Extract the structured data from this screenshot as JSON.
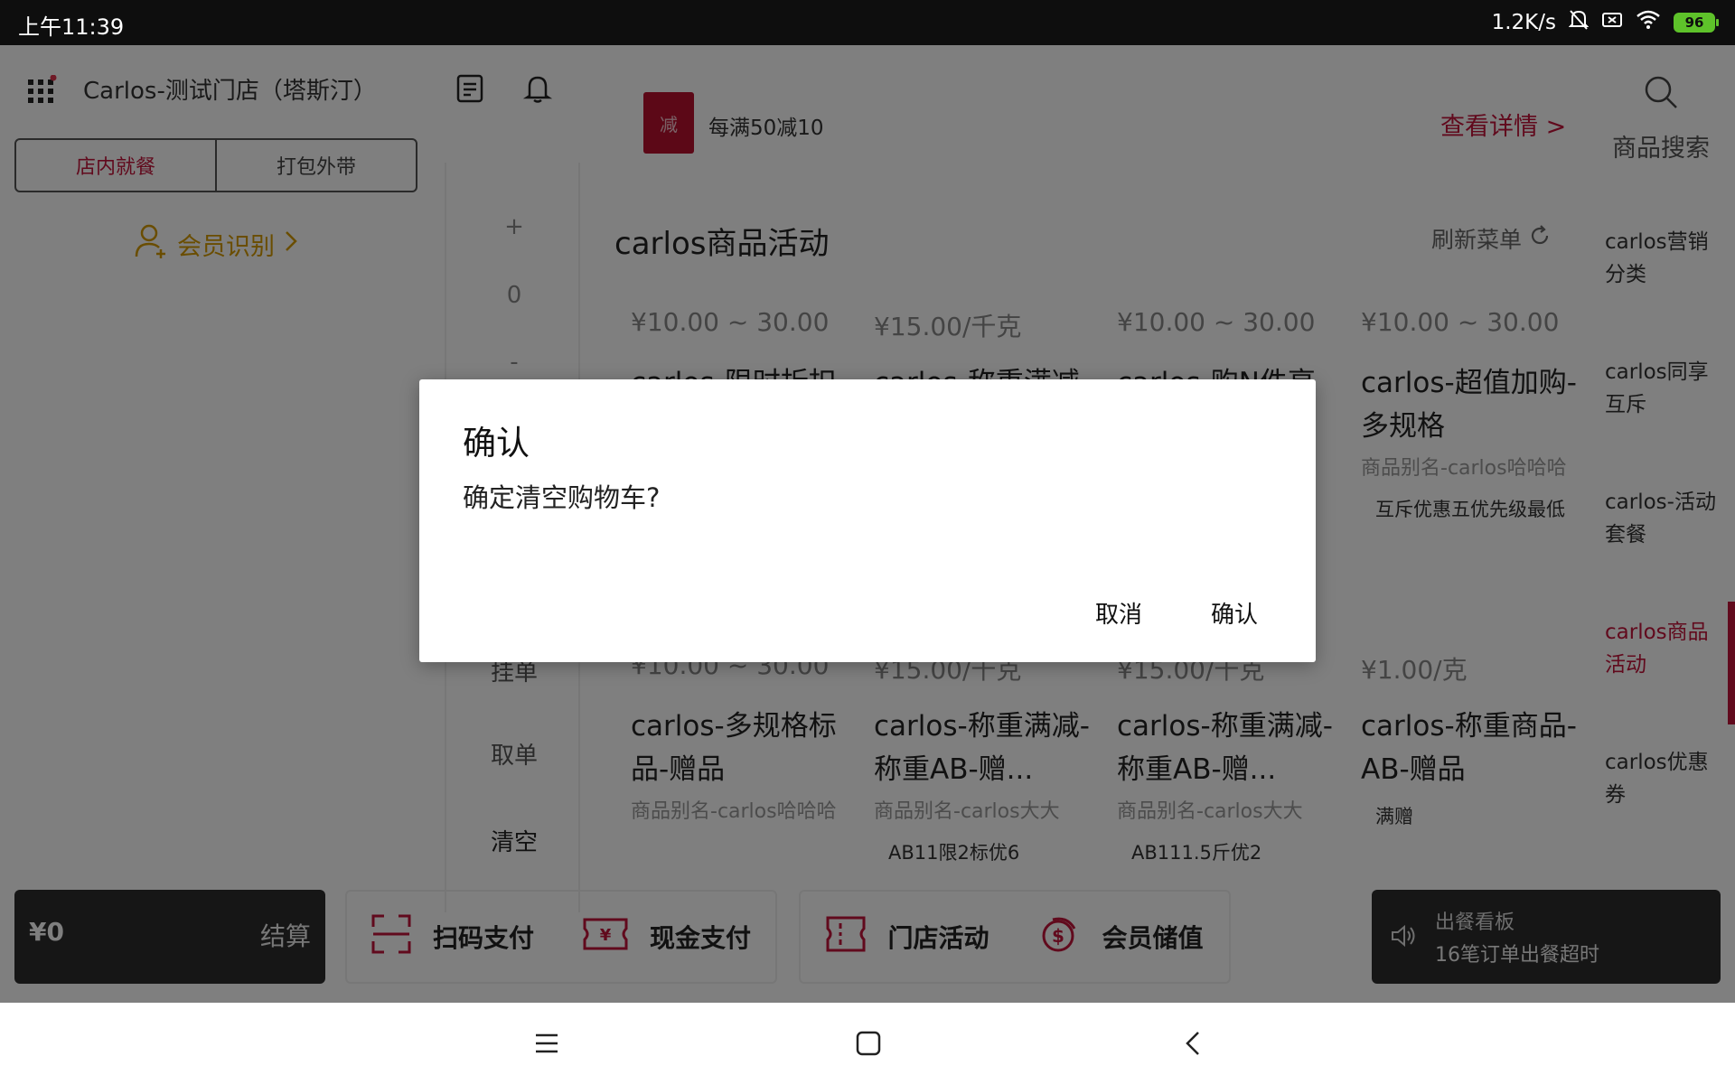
{
  "status_bar": {
    "time": "上午11:39",
    "net_speed": "1.2K/s",
    "battery": "96"
  },
  "header": {
    "store_name": "Carlos-测试门店（塔斯汀）"
  },
  "mode_tabs": [
    {
      "label": "店内就餐"
    },
    {
      "label": "打包外带"
    }
  ],
  "member": {
    "label": "会员识别"
  },
  "cart": {
    "plus": "+",
    "qty": "0",
    "minus": "-",
    "partial_label": "挂单",
    "cancel_order": "取单",
    "clear": "清空"
  },
  "promo": {
    "badge": "减",
    "text": "每满50减10",
    "detail_link": "查看详情 >"
  },
  "search": {
    "label": "商品搜索"
  },
  "categories": [
    {
      "label": "carlos营销分类"
    },
    {
      "label": "carlos同享互斥"
    },
    {
      "label": "carlos-活动套餐"
    },
    {
      "label": "carlos商品活动"
    },
    {
      "label": "carlos优惠券"
    }
  ],
  "section": {
    "title": "carlos商品活动",
    "refresh": "刷新菜单"
  },
  "products_row1": [
    {
      "price": "¥10.00 ~ 30.00",
      "name": "carlos-限时折扣",
      "alias": "",
      "tag": ""
    },
    {
      "price": "¥15.00/千克",
      "name": "carlos-称重满减",
      "alias": "",
      "tag": ""
    },
    {
      "price": "¥10.00 ~ 30.00",
      "name": "carlos-购N件享",
      "alias": "",
      "tag": ""
    },
    {
      "price": "¥10.00 ~ 30.00",
      "name": "carlos-超值加购-多规格",
      "alias": "商品别名-carlos哈哈哈",
      "tag": "互斥优惠五优先级最低"
    }
  ],
  "products_row2": [
    {
      "price": "¥10.00 ~ 30.00",
      "name": "carlos-多规格标品-赠品",
      "alias": "商品别名-carlos哈哈哈",
      "tag": ""
    },
    {
      "price": "¥15.00/千克",
      "name": "carlos-称重满减-称重AB-赠...",
      "alias": "商品别名-carlos大大",
      "tag": "AB11限2标优6"
    },
    {
      "price": "¥15.00/千克",
      "name": "carlos-称重满减-称重AB-赠...",
      "alias": "商品别名-carlos大大",
      "tag": "AB111.5斤优2"
    },
    {
      "price": "¥1.00/克",
      "name": "carlos-称重商品-AB-赠品",
      "alias": "",
      "tag": "满赠"
    }
  ],
  "checkout": {
    "amount": "¥0",
    "label": "结算"
  },
  "payments": [
    {
      "label": "扫码支付",
      "icon": "scan-icon"
    },
    {
      "label": "现金支付",
      "icon": "cash-icon"
    },
    {
      "label": "门店活动",
      "icon": "store-activity-icon"
    },
    {
      "label": "会员储值",
      "icon": "member-stored-value-icon"
    }
  ],
  "kitchen_board": {
    "title": "出餐看板",
    "message": "16笔订单出餐超时"
  },
  "dialog": {
    "title": "确认",
    "message": "确定清空购物车?",
    "cancel": "取消",
    "confirm": "确认"
  },
  "colors": {
    "accent": "#c3143a",
    "member": "#d49a00",
    "dark_panel": "#2c2c2c"
  }
}
